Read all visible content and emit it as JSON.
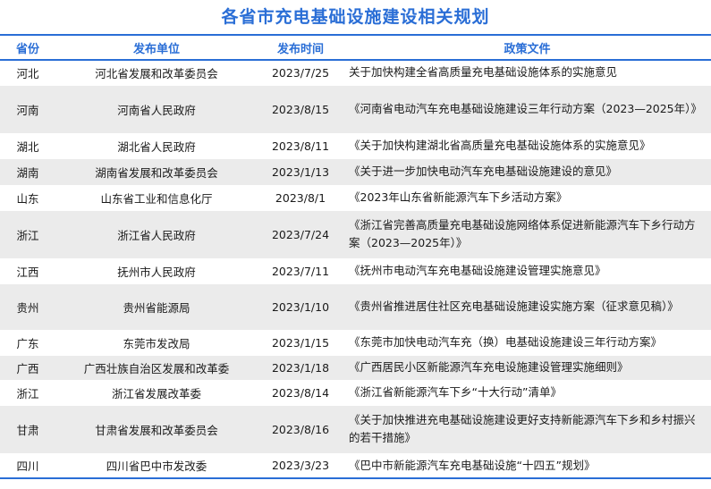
{
  "title": "各省市充电基础设施建设相关规划",
  "columns": [
    "省份",
    "发布单位",
    "发布时间",
    "政策文件"
  ],
  "rows": [
    {
      "province": "河北",
      "unit": "河北省发展和改革委员会",
      "date": "2023/7/25",
      "doc": "关于加快构建全省高质量充电基础设施体系的实施意见",
      "h": 28
    },
    {
      "province": "河南",
      "unit": "河南省人民政府",
      "date": "2023/8/15",
      "doc": "《河南省电动汽车充电基础设施建设三年行动方案（2023—2025年）》",
      "h": 54
    },
    {
      "province": "湖北",
      "unit": "湖北省人民政府",
      "date": "2023/8/11",
      "doc": "《关于加快构建湖北省高质量充电基础设施体系的实施意见》",
      "h": 28
    },
    {
      "province": "湖南",
      "unit": "湖南省发展和改革委员会",
      "date": "2023/1/13",
      "doc": "《关于进一步加快电动汽车充电基础设施建设的意见》",
      "h": 30
    },
    {
      "province": "山东",
      "unit": "山东省工业和信息化厅",
      "date": "2023/8/1",
      "doc": "《2023年山东省新能源汽车下乡活动方案》",
      "h": 28
    },
    {
      "province": "浙江",
      "unit": "浙江省人民政府",
      "date": "2023/7/24",
      "doc": "《浙江省完善高质量充电基础设施网络体系促进新能源汽车下乡行动方案（2023—2025年）》",
      "h": 54
    },
    {
      "province": "江西",
      "unit": "抚州市人民政府",
      "date": "2023/7/11",
      "doc": "《抚州市电动汽车充电基础设施建设管理实施意见》",
      "h": 28
    },
    {
      "province": "贵州",
      "unit": "贵州省能源局",
      "date": "2023/1/10",
      "doc": "《贵州省推进居住社区充电基础设施建设实施方案（征求意见稿）》",
      "h": 52
    },
    {
      "province": "广东",
      "unit": "东莞市发改局",
      "date": "2023/1/15",
      "doc": "《东莞市加快电动汽车充（换）电基础设施建设三年行动方案》",
      "h": 28
    },
    {
      "province": "广西",
      "unit": "广西壮族自治区发展和改革委",
      "date": "2023/1/18",
      "doc": "《广西居民小区新能源汽车充电设施建设管理实施细则》",
      "h": 28
    },
    {
      "province": "浙江",
      "unit": "浙江省发展改革委",
      "date": "2023/8/14",
      "doc": "《浙江省新能源汽车下乡“十大行动”清单》",
      "h": 28
    },
    {
      "province": "甘肃",
      "unit": "甘肃省发展和改革委员会",
      "date": "2023/8/16",
      "doc": "《关于加快推进充电基础设施建设更好支持新能源汽车下乡和乡村振兴的若干措施》",
      "h": 54
    },
    {
      "province": "四川",
      "unit": "四川省巴中市发改委",
      "date": "2023/3/23",
      "doc": "《巴中市新能源汽车充电基础设施“十四五”规划》",
      "h": 28
    }
  ]
}
